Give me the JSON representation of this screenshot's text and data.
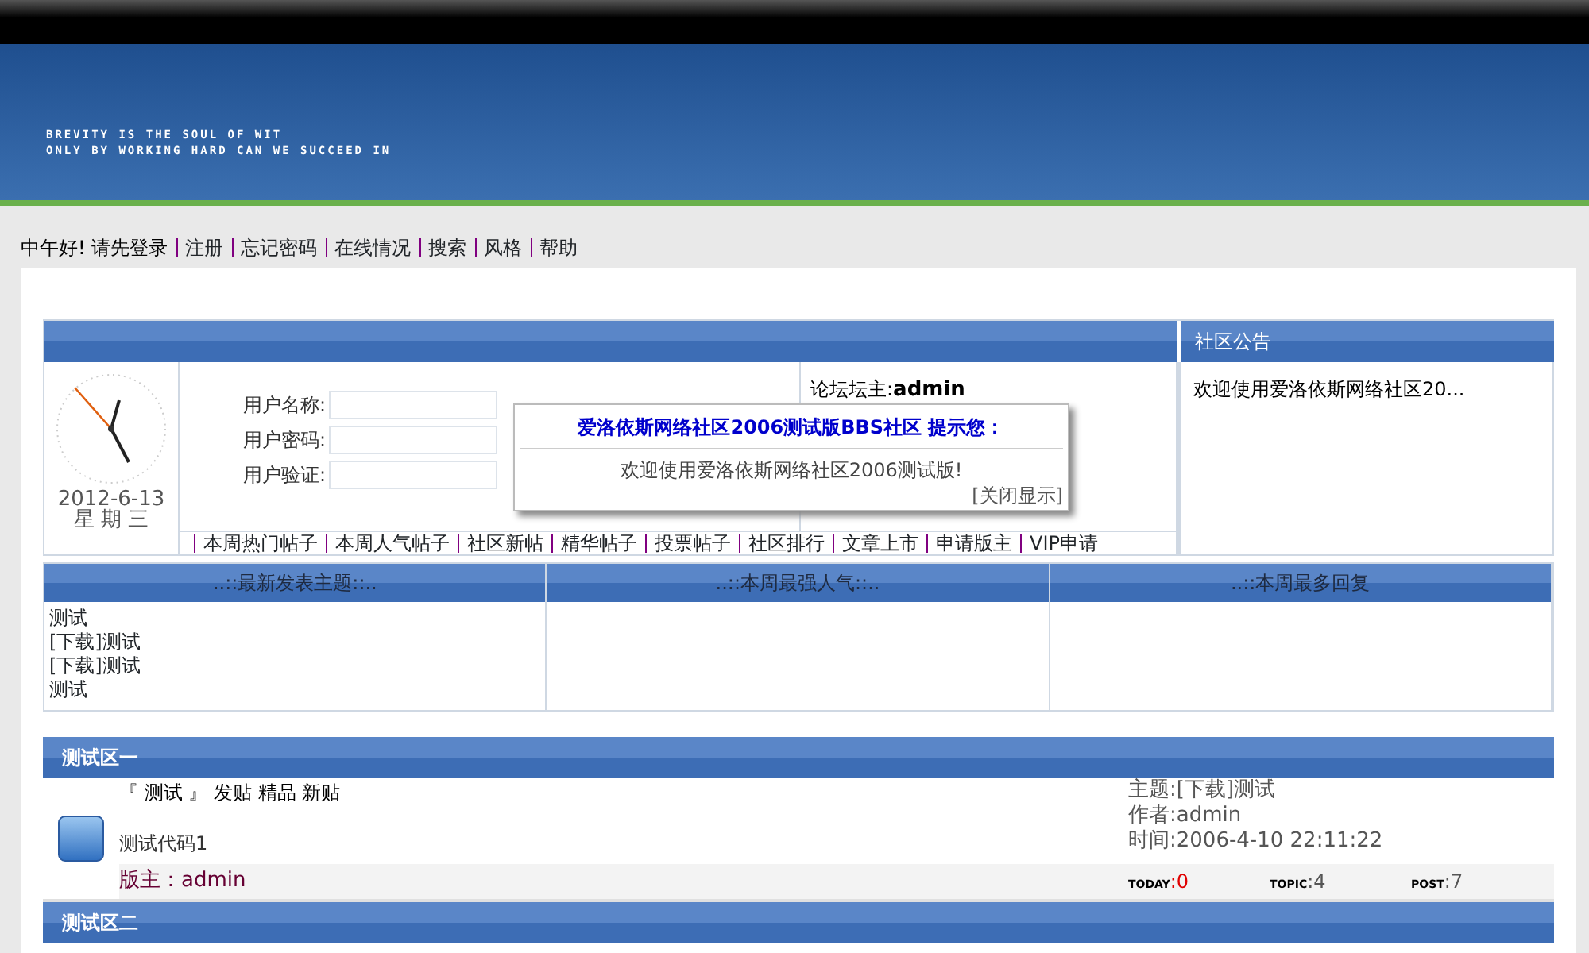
{
  "banner": {
    "lines": [
      "BREVITY IS THE SOUL OF WIT",
      "ONLY BY WORKING HARD CAN WE SUCCEED IN"
    ]
  },
  "nav": {
    "greeting": "中午好! 请先登录",
    "links": [
      "注册",
      "忘记密码",
      "在线情况",
      "搜索",
      "风格",
      "帮助"
    ]
  },
  "login": {
    "fields": [
      {
        "label": "用户名称:"
      },
      {
        "label": "用户密码:"
      },
      {
        "label": "用户验证:"
      }
    ],
    "date": "2012-6-13",
    "weekday": "星 期 三",
    "owner_label": "论坛坛主:",
    "owner": "admin"
  },
  "quick_links": [
    "本周热门帖子",
    "本周人气帖子",
    "社区新帖",
    "精华帖子",
    "投票帖子",
    "社区排行",
    "文章上市",
    "申请版主",
    "VIP申请"
  ],
  "notice": {
    "title": "社区公告",
    "text": "欢迎使用爱洛依斯网络社区20..."
  },
  "popup": {
    "title": "爱洛依斯网络社区2006测试版BBS社区  提示您：",
    "message": "欢迎使用爱洛依斯网络社区2006测试版!",
    "close": "[关闭显示]"
  },
  "stats": {
    "columns": [
      {
        "title": "..::最新发表主题::..",
        "items": [
          "测试",
          "[下载]测试",
          "[下载]测试",
          "测试"
        ]
      },
      {
        "title": "..::本周最强人气::.."
      },
      {
        "title": "..::本周最多回复"
      }
    ]
  },
  "forums": [
    {
      "title": "测试区一",
      "name": "『 测试 』 发贴 精品 新贴",
      "desc": "测试代码1",
      "moderator": "版主：admin",
      "topic": "主题:[下载]测试",
      "author": "作者:admin",
      "time": "时间:2006-4-10 22:11:22",
      "counts": [
        {
          "label": "TODAY",
          "value": ":0",
          "highlight": true
        },
        {
          "label": "TOPIC",
          "value": ":4",
          "highlight": false
        },
        {
          "label": "POST",
          "value": ":7",
          "highlight": false
        }
      ]
    },
    {
      "title": "测试区二"
    }
  ]
}
